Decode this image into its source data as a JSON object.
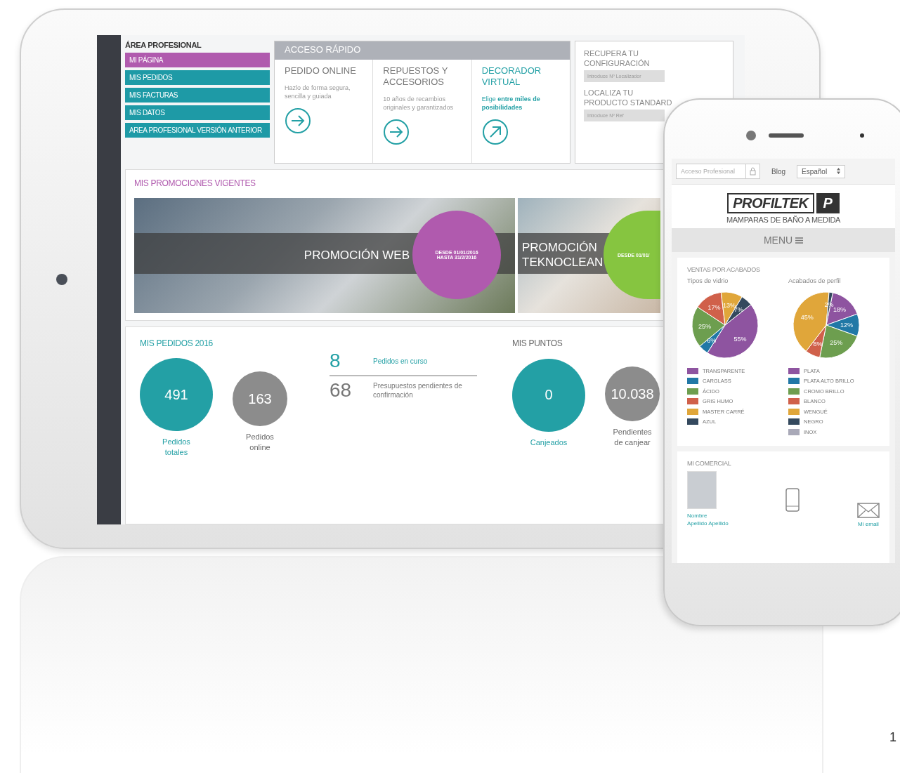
{
  "tablet": {
    "sidebar": {
      "title": "ÁREA PROFESIONAL",
      "items": [
        {
          "label": "MI PÁGINA",
          "selected": true
        },
        {
          "label": "MIS PEDIDOS",
          "selected": false
        },
        {
          "label": "MIS FACTURAS",
          "selected": false
        },
        {
          "label": "MIS DATOS",
          "selected": false
        },
        {
          "label": "AREA PROFESIONAL VERSIÓN ANTERIOR",
          "selected": false
        }
      ]
    },
    "quick_access": {
      "title": "ACCESO RÁPIDO",
      "cards": [
        {
          "title": "PEDIDO ONLINE",
          "text": "Hazlo de forma segura, sencilla y guiada",
          "kind": "internal"
        },
        {
          "title": "REPUESTOS Y ACCESORIOS",
          "text": "10 años de recambios originales y garantizados",
          "kind": "internal"
        },
        {
          "title": "DECORADOR VIRTUAL",
          "text": "Elige **entre miles de posibilidades**",
          "kind": "external"
        }
      ]
    },
    "lookups": [
      {
        "title": "RECUPERA TU CONFIGURACIÓN",
        "placeholder": "Introduce Nº Localizador"
      },
      {
        "title": "LOCALIZA TU PRODUCTO STANDARD",
        "placeholder": "Introduce Nº Ref"
      }
    ],
    "promotions": {
      "title": "MIS PROMOCIONES VIGENTES",
      "items": [
        {
          "title": "PROMOCIÓN WEB",
          "date_from": "DESDE 01/01/2016",
          "date_to": "HASTA 31/2/2016",
          "color": "#b05aae"
        },
        {
          "title": "PROMOCIÓN TEKNOCLEAN",
          "date_from": "DESDE 01/01/",
          "color": "#86c540"
        }
      ]
    },
    "orders": {
      "title": "MIS PEDIDOS 2016",
      "stats": [
        {
          "value": "491",
          "label": "Pedidos totales",
          "color": "#23a0a5"
        },
        {
          "value": "163",
          "label": "Pedidos online",
          "color": "#8c8c8c"
        }
      ],
      "pending": [
        {
          "value": "8",
          "label": "Pedidos en curso",
          "color": "#23a0a5"
        },
        {
          "value": "68",
          "label": "Presupuestos pendientes de confirmación",
          "color": "#777777"
        }
      ]
    },
    "points": {
      "title": "MIS PUNTOS",
      "stats": [
        {
          "value": "0",
          "label": "Canjeados",
          "color": "#23a0a5"
        },
        {
          "value": "10.038",
          "label": "Pendientes de canjear",
          "color": "#8c8c8c"
        }
      ]
    }
  },
  "phone": {
    "topbar": {
      "login_placeholder": "Acceso Profesional",
      "blog": "Blog",
      "language": "Español"
    },
    "logo": {
      "name": "PROFILTEK",
      "mark": "P",
      "tagline": "MAMPARAS DE BAÑO A MEDIDA"
    },
    "menu": "MENU",
    "sales": {
      "title": "VENTAS POR ACABADOS",
      "charts": [
        {
          "legend": [
            {
              "color": "#8e54a0"
            },
            {
              "color": "#2178a6"
            },
            {
              "color": "#6d9e4f"
            },
            {
              "color": "#d0604a"
            },
            {
              "color": "#e0a63a"
            },
            {
              "color": "#34495e"
            }
          ],
          "chart_data": {
            "type": "pie",
            "title": "Tipos de vidrio",
            "categories": [
              "TRANSPARENTE",
              "CARGLASS",
              "ÁCIDO",
              "GRIS HUMO",
              "MASTER CARRÉ",
              "AZUL"
            ],
            "values": [
              55,
              6,
              25,
              17,
              13,
              7
            ],
            "value_labels": [
              "55%",
              "6%",
              "25%",
              "17%",
              "13%",
              "7%"
            ]
          }
        },
        {
          "legend": [
            {
              "color": "#8e54a0"
            },
            {
              "color": "#2178a6"
            },
            {
              "color": "#6d9e4f"
            },
            {
              "color": "#d0604a"
            },
            {
              "color": "#e0a63a"
            },
            {
              "color": "#34495e"
            },
            {
              "color": "#a9a9b8"
            }
          ],
          "chart_data": {
            "type": "pie",
            "title": "Acabados de perfil",
            "categories": [
              "PLATA",
              "PLATA ALTO BRILLO",
              "CROMO BRILLO",
              "BLANCO",
              "WENGUÉ",
              "NEGRO",
              "INOX"
            ],
            "values": [
              18,
              12,
              25,
              8,
              45,
              2,
              null
            ],
            "value_labels": [
              "18%",
              "12%",
              "25%",
              "8%",
              "45%",
              "2%",
              null
            ]
          }
        }
      ]
    },
    "comercial": {
      "title": "MI COMERCIAL",
      "name": "Nombre",
      "surname": "Apellido Apellido",
      "email": "Mi email"
    }
  },
  "page_number": "1"
}
